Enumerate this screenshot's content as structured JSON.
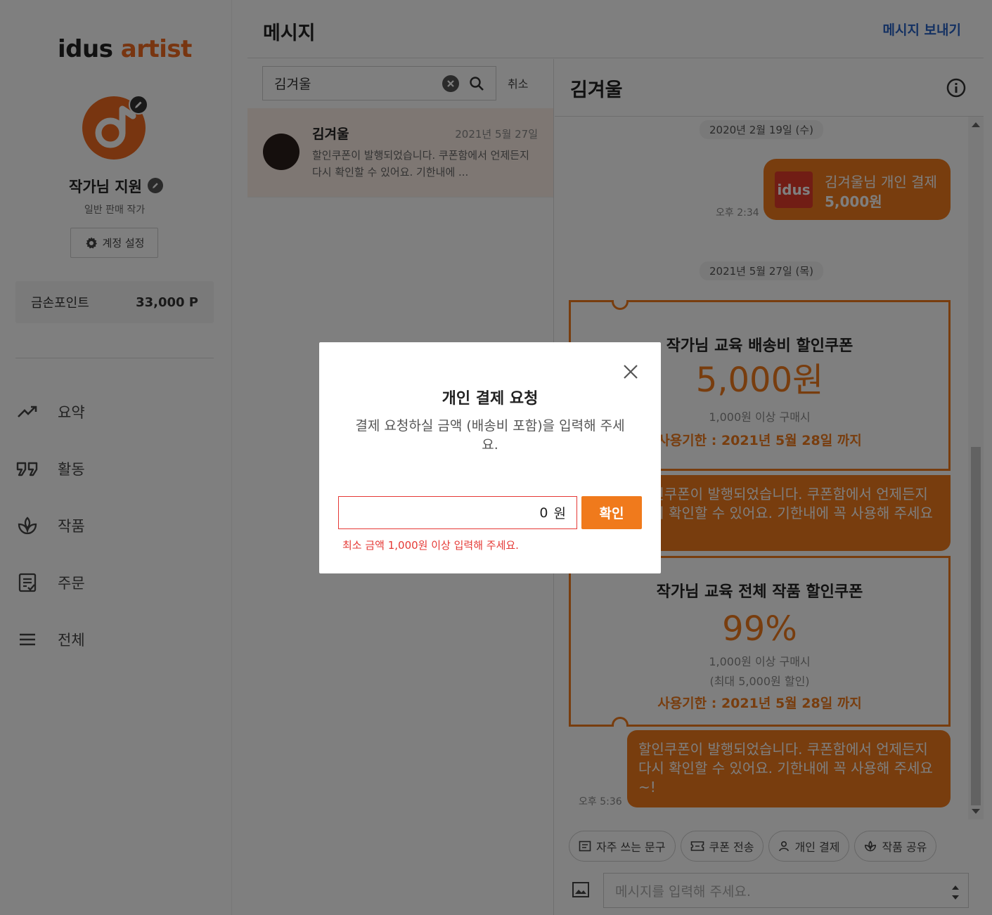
{
  "brand": {
    "logo_left": "idus",
    "logo_right": "artist",
    "accent": "#f16b20"
  },
  "profile": {
    "name": "작가님 지원",
    "subtitle": "일반 판매 작가",
    "settings_label": "계정 설정"
  },
  "points": {
    "label": "금손포인트",
    "value": "33,000 P"
  },
  "nav": [
    {
      "label": "요약",
      "icon": "trending-up-icon"
    },
    {
      "label": "활동",
      "icon": "quote-icon"
    },
    {
      "label": "작품",
      "icon": "plant-icon"
    },
    {
      "label": "주문",
      "icon": "order-list-icon"
    },
    {
      "label": "전체",
      "icon": "menu-icon"
    }
  ],
  "header": {
    "title": "메시지",
    "send_message": "메시지 보내기"
  },
  "search": {
    "value": "김겨울",
    "cancel": "취소"
  },
  "conversations": [
    {
      "name": "김겨울",
      "date": "2021년 5월 27일",
      "preview": "할인쿠폰이 발행되었습니다. 쿠폰함에서 언제든지 다시 확인할 수 있어요. 기한내에 ..."
    }
  ],
  "chat": {
    "name": "김겨울",
    "date1": "2020년 2월 19일 (수)",
    "payment": {
      "logo": "idus",
      "title": "김겨울님 개인 결제",
      "amount": "5,000원",
      "time": "오후 2:34"
    },
    "date2": "2021년 5월 27일 (목)",
    "coupon1": {
      "title": "작가님 교육 배송비 할인쿠폰",
      "value": "5,000원",
      "condition": "1,000원 이상 구매시",
      "expiry": "사용기한 : 2021년 5월 28일 까지"
    },
    "message1": "할인쿠폰이 발행되었습니다. 쿠폰함에서 언제든지 다시 확인할 수 있어요. 기한내에 꼭 사용해 주세요",
    "coupon2": {
      "title": "작가님 교육 전체 작품 할인쿠폰",
      "value": "99%",
      "condition": "1,000원 이상 구매시",
      "max": "(최대 5,000원 할인)",
      "expiry": "사용기한 : 2021년 5월 28일 까지"
    },
    "message2": "할인쿠폰이 발행되었습니다. 쿠폰함에서 언제든지 다시 확인할 수 있어요. 기한내에 꼭 사용해 주세요~!",
    "message2_time": "오후 5:36"
  },
  "quick_actions": [
    "자주 쓰는 문구",
    "쿠폰 전송",
    "개인 결제",
    "작품 공유"
  ],
  "compose": {
    "placeholder": "메시지를 입력해 주세요."
  },
  "modal": {
    "title": "개인 결제 요청",
    "description": "결제 요청하실 금액 (배송비 포함)을 입력해 주세요.",
    "amount_value": "0",
    "amount_unit": "원",
    "confirm": "확인",
    "error": "최소 금액 1,000원 이상 입력해 주세요."
  }
}
